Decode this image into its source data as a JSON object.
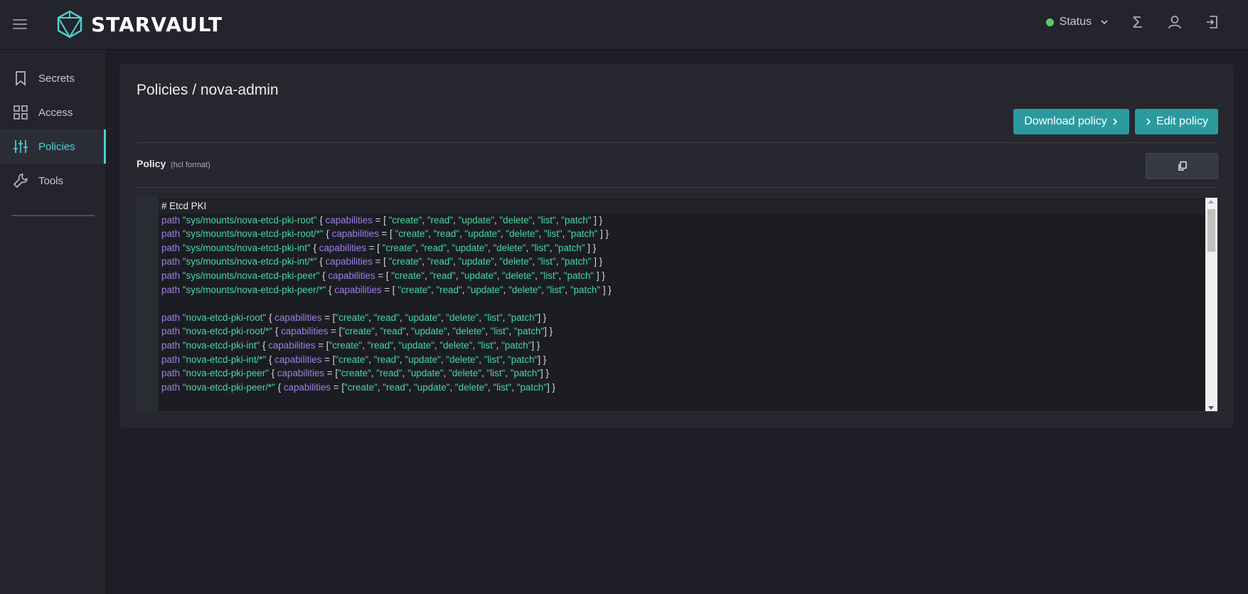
{
  "app": {
    "name": "STARVAULT"
  },
  "topbar": {
    "status_label": "Status",
    "status_color": "#5ec86a"
  },
  "sidebar": {
    "items": [
      {
        "label": "Secrets",
        "icon": "bookmark-icon",
        "active": false
      },
      {
        "label": "Access",
        "icon": "grid-icon",
        "active": false
      },
      {
        "label": "Policies",
        "icon": "sliders-icon",
        "active": true
      },
      {
        "label": "Tools",
        "icon": "wrench-icon",
        "active": false
      }
    ]
  },
  "main": {
    "title": "Policies / nova-admin",
    "download_label": "Download policy",
    "edit_label": "Edit policy",
    "policy_label": "Policy",
    "policy_format": "(hcl format)"
  },
  "editor": {
    "comment": "# Etcd PKI",
    "lines": [
      {
        "path": "sys/mounts/nova-etcd-pki-root",
        "style": "spaced"
      },
      {
        "path": "sys/mounts/nova-etcd-pki-root/*",
        "style": "spaced"
      },
      {
        "path": "sys/mounts/nova-etcd-pki-int",
        "style": "spaced"
      },
      {
        "path": "sys/mounts/nova-etcd-pki-int/*",
        "style": "spaced"
      },
      {
        "path": "sys/mounts/nova-etcd-pki-peer",
        "style": "spaced"
      },
      {
        "path": "sys/mounts/nova-etcd-pki-peer/*",
        "style": "spaced"
      },
      {
        "path": "",
        "style": "blank"
      },
      {
        "path": "nova-etcd-pki-root",
        "style": "tight"
      },
      {
        "path": "nova-etcd-pki-root/*",
        "style": "tight"
      },
      {
        "path": "nova-etcd-pki-int",
        "style": "tight"
      },
      {
        "path": "nova-etcd-pki-int/*",
        "style": "tight"
      },
      {
        "path": "nova-etcd-pki-peer",
        "style": "tight"
      },
      {
        "path": "nova-etcd-pki-peer/*",
        "style": "tight"
      }
    ],
    "keyword_path": "path",
    "keyword_capabilities": "capabilities",
    "capabilities": [
      "create",
      "read",
      "update",
      "delete",
      "list",
      "patch"
    ],
    "colors": {
      "keyword": "#9f7fe3",
      "string": "#47d8a3"
    }
  }
}
